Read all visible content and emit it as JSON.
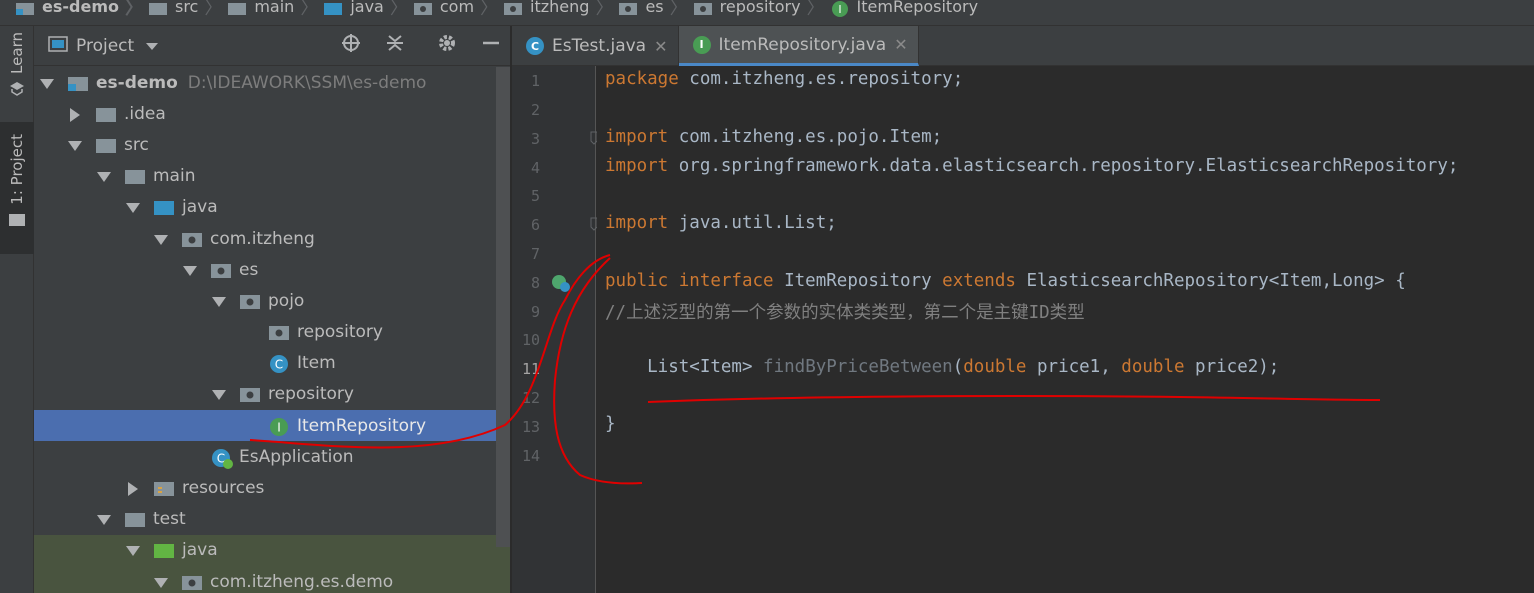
{
  "breadcrumb": [
    "es-demo",
    "src",
    "main",
    "java",
    "com",
    "itzheng",
    "es",
    "repository",
    "ItemRepository"
  ],
  "strip": {
    "learn": "Learn",
    "project": "1: Project"
  },
  "project_panel": {
    "title": "Project",
    "root": {
      "name": "es-demo",
      "path": "D:\\IDEAWORK\\SSM\\es-demo"
    },
    "nodes": [
      ".idea",
      "src",
      "main",
      "java",
      "com.itzheng",
      "es",
      "pojo",
      "repository",
      "Item",
      "repository",
      "ItemRepository",
      "EsApplication",
      "resources",
      "test",
      "java",
      "com.itzheng.es.demo"
    ]
  },
  "tabs": [
    {
      "label": "EsTest.java",
      "badge": "C",
      "active": false
    },
    {
      "label": "ItemRepository.java",
      "badge": "I",
      "active": true
    }
  ],
  "editor": {
    "line_numbers": [
      "1",
      "2",
      "3",
      "4",
      "5",
      "6",
      "7",
      "8",
      "9",
      "10",
      "11",
      "12",
      "13",
      "14"
    ],
    "lines": {
      "l1_kw": "package",
      "l1_rest": " com.itzheng.es.repository;",
      "l3_kw": "import",
      "l3_rest": " com.itzheng.es.pojo.Item;",
      "l4_kw": "import",
      "l4_rest": " org.springframework.data.elasticsearch.repository.ElasticsearchRepository;",
      "l6_kw": "import",
      "l6_rest": " java.util.List;",
      "l8_kw1": "public interface",
      "l8_name": " ItemRepository ",
      "l8_kw2": "extends",
      "l8_rest": " ElasticsearchRepository<Item,Long> {",
      "l9_comment": "//上述泛型的第一个参数的实体类类型，第二个是主键ID类型",
      "l11_a": "    List<Item> ",
      "l11_fn": "findByPriceBetween",
      "l11_b": "(",
      "l11_kw1": "double",
      "l11_c": " price1, ",
      "l11_kw2": "double",
      "l11_d": " price2);",
      "l13": "}"
    }
  },
  "colors": {
    "keyword": "#cc7832",
    "selection": "#4b6eaf",
    "annotation": "#e00000"
  }
}
